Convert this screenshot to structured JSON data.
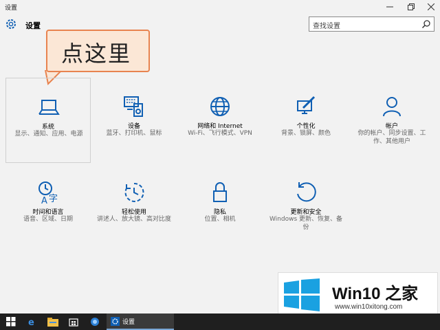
{
  "window": {
    "title": "设置"
  },
  "header": {
    "title": "设置",
    "search_placeholder": "查找设置"
  },
  "callout": {
    "text": "点这里"
  },
  "tiles": [
    {
      "name": "系统",
      "desc": "显示、通知、应用、电源",
      "icon": "laptop-icon"
    },
    {
      "name": "设备",
      "desc": "蓝牙、打印机、鼠标",
      "icon": "devices-icon"
    },
    {
      "name": "网络和 Internet",
      "desc": "Wi-Fi、飞行模式、VPN",
      "icon": "globe-icon"
    },
    {
      "name": "个性化",
      "desc": "背景、锁屏、颜色",
      "icon": "paintbrush-icon"
    },
    {
      "name": "帐户",
      "desc": "你的帐户、同步设置、工作、其他用户",
      "icon": "person-icon"
    },
    {
      "name": "时间和语言",
      "desc": "语音、区域、日期",
      "icon": "time-language-icon"
    },
    {
      "name": "轻松使用",
      "desc": "讲述人、放大镜、高对比度",
      "icon": "ease-of-access-icon"
    },
    {
      "name": "隐私",
      "desc": "位置、相机",
      "icon": "lock-icon"
    },
    {
      "name": "更新和安全",
      "desc": "Windows 更新、恢复、备份",
      "icon": "update-icon"
    }
  ],
  "taskbar": {
    "active_app_label": "设置"
  },
  "branding": {
    "name": "Win10 之家",
    "url": "www.win10xitong.com"
  },
  "colors": {
    "accent": "#0f5fb3",
    "callout_fill": "#fbe7d6",
    "callout_border": "#e8834f",
    "taskbar": "#1f1f1f"
  }
}
